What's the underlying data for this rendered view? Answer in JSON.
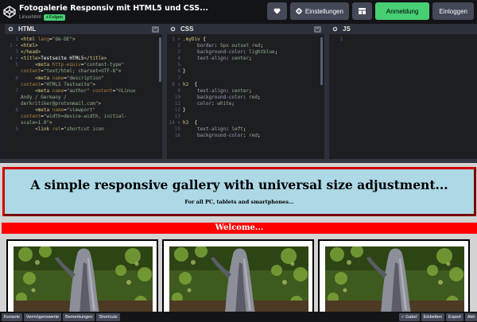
{
  "header": {
    "pen_title": "Fotogalerie Responsiv mit HTML5 und CSS...",
    "author": "Linuxhtml",
    "follow_label": "Folgen",
    "settings_label": "Einstellungen",
    "signup_label": "Anmeldung",
    "login_label": "Einloggen"
  },
  "editors": {
    "html_label": "HTML",
    "css_label": "CSS",
    "js_label": "JS"
  },
  "html_code": [
    {
      "n": "1",
      "parts": [
        [
          "t-tag",
          "<html "
        ],
        [
          "t-attr",
          "lang"
        ],
        [
          "t-plain",
          "="
        ],
        [
          "t-str",
          "\"de-DE\""
        ],
        [
          "t-tag",
          ">"
        ]
      ]
    },
    {
      "n": "2 ▾",
      "parts": [
        [
          "t-tag",
          "<html>"
        ]
      ]
    },
    {
      "n": "3",
      "parts": [
        [
          "t-tag",
          "</head>"
        ]
      ]
    },
    {
      "n": "4 ▾",
      "parts": [
        [
          "t-tag",
          "<title>"
        ],
        [
          "t-plain",
          "Testseite HTML5"
        ],
        [
          "t-tag",
          "</title>"
        ]
      ]
    },
    {
      "n": "5",
      "parts": [
        [
          "t-plain",
          "     "
        ],
        [
          "t-tag",
          "<meta "
        ],
        [
          "t-attr",
          "http-equiv"
        ],
        [
          "t-plain",
          "="
        ],
        [
          "t-str",
          "\"content-type\""
        ]
      ]
    },
    {
      "n": "",
      "parts": [
        [
          "t-attr",
          "content"
        ],
        [
          "t-plain",
          "="
        ],
        [
          "t-str",
          "\"text/html; charset=UTF-8\""
        ],
        [
          "t-tag",
          ">"
        ]
      ]
    },
    {
      "n": "6",
      "parts": [
        [
          "t-plain",
          "     "
        ],
        [
          "t-tag",
          "<meta "
        ],
        [
          "t-attr",
          "name"
        ],
        [
          "t-plain",
          "="
        ],
        [
          "t-str",
          "\"description\""
        ]
      ]
    },
    {
      "n": "",
      "parts": [
        [
          "t-attr",
          "content"
        ],
        [
          "t-plain",
          "="
        ],
        [
          "t-str",
          "\"HTML5 Testseite\""
        ],
        [
          "t-tag",
          ">"
        ]
      ]
    },
    {
      "n": "7",
      "parts": [
        [
          "t-plain",
          "     "
        ],
        [
          "t-tag",
          "<meta "
        ],
        [
          "t-attr",
          "name"
        ],
        [
          "t-plain",
          "="
        ],
        [
          "t-str",
          "\"author\" "
        ],
        [
          "t-attr",
          "content"
        ],
        [
          "t-plain",
          "="
        ],
        [
          "t-str",
          "\"©Linux"
        ]
      ]
    },
    {
      "n": "",
      "parts": [
        [
          "t-str",
          "Andy / Germany /"
        ]
      ]
    },
    {
      "n": "",
      "parts": [
        [
          "t-str",
          "derkritiker@protonmail.com\""
        ],
        [
          "t-tag",
          ">"
        ]
      ]
    },
    {
      "n": "8",
      "parts": [
        [
          "t-plain",
          "     "
        ],
        [
          "t-tag",
          "<meta "
        ],
        [
          "t-attr",
          "name"
        ],
        [
          "t-plain",
          "="
        ],
        [
          "t-str",
          "\"viewport\""
        ]
      ]
    },
    {
      "n": "",
      "parts": [
        [
          "t-attr",
          "content"
        ],
        [
          "t-plain",
          "="
        ],
        [
          "t-str",
          "\"width=device-width, initial-"
        ]
      ]
    },
    {
      "n": "",
      "parts": [
        [
          "t-str",
          "scale=1.0\""
        ],
        [
          "t-tag",
          ">"
        ]
      ]
    },
    {
      "n": "9",
      "parts": [
        [
          "t-plain",
          "     "
        ],
        [
          "t-tag",
          "<link "
        ],
        [
          "t-attr",
          "rel"
        ],
        [
          "t-plain",
          "="
        ],
        [
          "t-str",
          "\"shortcut icon"
        ]
      ]
    }
  ],
  "css_code": [
    {
      "n": "1 ▾",
      "parts": [
        [
          "t-sel",
          ".myDiv "
        ],
        [
          "t-plain",
          "{"
        ]
      ]
    },
    {
      "n": "2",
      "parts": [
        [
          "t-prop",
          "     border"
        ],
        [
          "t-plain",
          ": "
        ],
        [
          "t-val",
          "5px outset red"
        ],
        [
          "t-plain",
          ";"
        ]
      ]
    },
    {
      "n": "3",
      "parts": [
        [
          "t-prop",
          "     background-color"
        ],
        [
          "t-plain",
          ": "
        ],
        [
          "t-val",
          "lightblue"
        ],
        [
          "t-plain",
          ";"
        ]
      ]
    },
    {
      "n": "4",
      "parts": [
        [
          "t-prop",
          "     text-align"
        ],
        [
          "t-plain",
          ": "
        ],
        [
          "t-val",
          "center"
        ],
        [
          "t-plain",
          ";"
        ]
      ]
    },
    {
      "n": "5",
      "parts": []
    },
    {
      "n": "6",
      "parts": [
        [
          "t-plain",
          "}"
        ]
      ]
    },
    {
      "n": "7",
      "parts": []
    },
    {
      "n": "8 ▾",
      "parts": [
        [
          "t-sel",
          "h2  "
        ],
        [
          "t-plain",
          "{"
        ]
      ]
    },
    {
      "n": "9",
      "parts": [
        [
          "t-prop",
          "     text-align"
        ],
        [
          "t-plain",
          ": "
        ],
        [
          "t-val",
          "center"
        ],
        [
          "t-plain",
          ";"
        ]
      ]
    },
    {
      "n": "10",
      "parts": [
        [
          "t-prop",
          "     background-color"
        ],
        [
          "t-plain",
          ": "
        ],
        [
          "t-val",
          "red"
        ],
        [
          "t-plain",
          ";"
        ]
      ]
    },
    {
      "n": "11",
      "parts": [
        [
          "t-prop",
          "     color"
        ],
        [
          "t-plain",
          ": "
        ],
        [
          "t-val",
          "white"
        ],
        [
          "t-plain",
          ";"
        ]
      ]
    },
    {
      "n": "12",
      "parts": [
        [
          "t-plain",
          "}"
        ]
      ]
    },
    {
      "n": "13",
      "parts": []
    },
    {
      "n": "14 ▾",
      "parts": [
        [
          "t-sel",
          "h3  "
        ],
        [
          "t-plain",
          "{"
        ]
      ]
    },
    {
      "n": "15",
      "parts": [
        [
          "t-prop",
          "     text-align"
        ],
        [
          "t-plain",
          ": "
        ],
        [
          "t-val",
          "left"
        ],
        [
          "t-plain",
          ";"
        ]
      ]
    },
    {
      "n": "16",
      "parts": [
        [
          "t-prop",
          "     background-color"
        ],
        [
          "t-plain",
          ": "
        ],
        [
          "t-val",
          "red"
        ],
        [
          "t-plain",
          ";"
        ]
      ]
    }
  ],
  "js_code": [
    {
      "n": "1",
      "parts": []
    }
  ],
  "preview": {
    "heading": "A simple responsive gallery with universal size adjustment...",
    "subheading": "For all PC, tablets and smartphones...",
    "welcome": "Welcome..."
  },
  "bottom_bar": {
    "console": "Konsole",
    "assets": "Vermögenswerte",
    "comments": "Bemerkungen",
    "shortcuts": "Shortcuts",
    "fork": "Gabel",
    "embed": "Einbetten",
    "export": "Export",
    "share": "Akti"
  },
  "colors": {
    "accent_green": "#47cf73",
    "editor_bg": "#1d1e22",
    "header_bg": "#131417",
    "button_grey": "#444857",
    "welcome_red": "#ff0000",
    "mydiv_bg": "#add8e6"
  }
}
